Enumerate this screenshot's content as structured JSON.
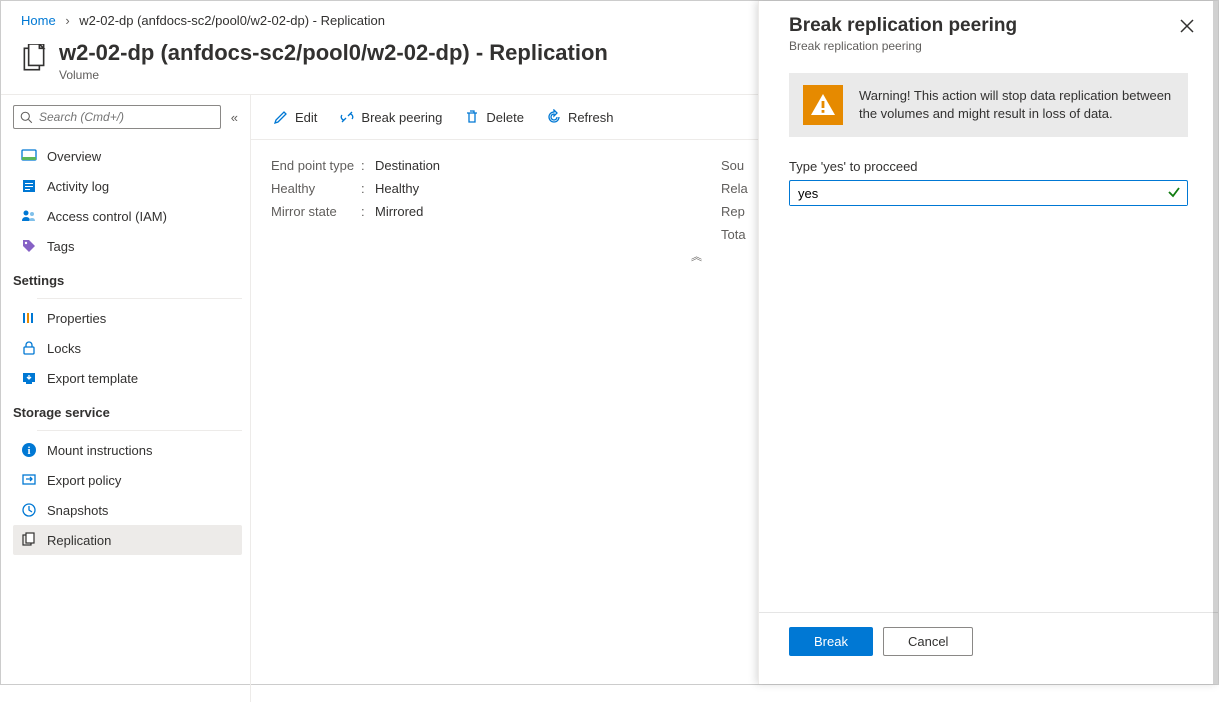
{
  "breadcrumb": {
    "home": "Home",
    "current": "w2-02-dp (anfdocs-sc2/pool0/w2-02-dp) - Replication"
  },
  "header": {
    "title": "w2-02-dp (anfdocs-sc2/pool0/w2-02-dp) - Replication",
    "subtitle": "Volume"
  },
  "sidebar": {
    "search_placeholder": "Search (Cmd+/)",
    "items_core": [
      {
        "label": "Overview"
      },
      {
        "label": "Activity log"
      },
      {
        "label": "Access control (IAM)"
      },
      {
        "label": "Tags"
      }
    ],
    "section_settings": "Settings",
    "items_settings": [
      {
        "label": "Properties"
      },
      {
        "label": "Locks"
      },
      {
        "label": "Export template"
      }
    ],
    "section_storage": "Storage service",
    "items_storage": [
      {
        "label": "Mount instructions"
      },
      {
        "label": "Export policy"
      },
      {
        "label": "Snapshots"
      },
      {
        "label": "Replication"
      }
    ]
  },
  "toolbar": {
    "edit": "Edit",
    "break": "Break peering",
    "delete": "Delete",
    "refresh": "Refresh"
  },
  "details": {
    "rows": [
      {
        "label": "End point type",
        "value": "Destination"
      },
      {
        "label": "Healthy",
        "value": "Healthy"
      },
      {
        "label": "Mirror state",
        "value": "Mirrored"
      }
    ],
    "right_labels": [
      "Sou",
      "Rela",
      "Rep",
      "Tota"
    ]
  },
  "flyout": {
    "title": "Break replication peering",
    "subtitle": "Break replication peering",
    "warning": "Warning! This action will stop data replication between the volumes and might result in loss of data.",
    "input_label": "Type 'yes' to procceed",
    "input_value": "yes",
    "btn_primary": "Break",
    "btn_secondary": "Cancel"
  }
}
